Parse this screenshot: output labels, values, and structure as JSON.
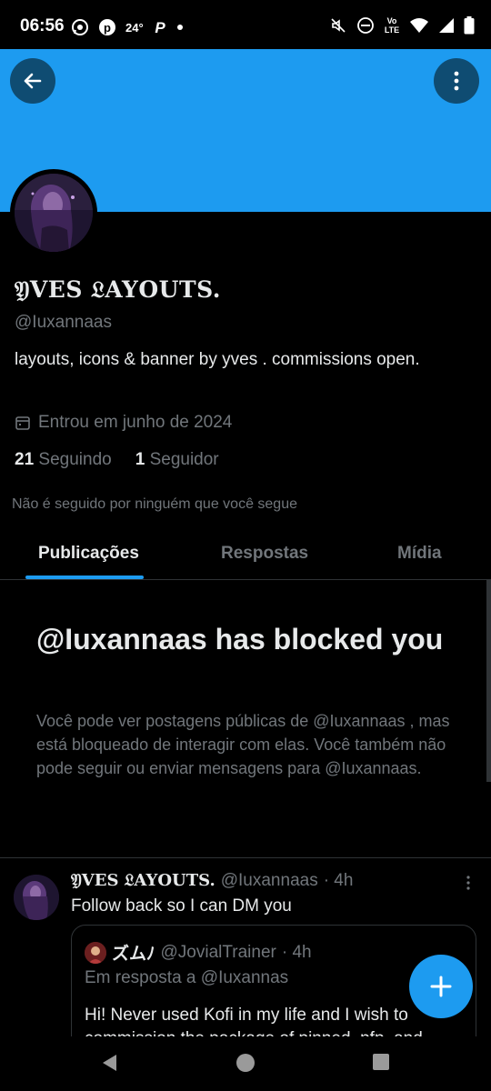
{
  "status_bar": {
    "time": "06:56",
    "temperature": "24°",
    "lte_label": "Vo LTE",
    "icons_left": [
      "whatsapp-icon",
      "pinterest-icon",
      "paypal-icon",
      "dot-icon"
    ],
    "icons_right": [
      "mute-icon",
      "dnd-icon",
      "volte-icon",
      "wifi-icon",
      "signal-icon",
      "battery-icon"
    ]
  },
  "header": {
    "back_icon": "arrow-left-icon",
    "more_icon": "more-vertical-icon",
    "banner_color": "#1d9bf0"
  },
  "profile": {
    "display_name": "𝔜VES 𝔏AYOUTS.",
    "handle": "@Iuxannaas",
    "bio": "layouts,  icons  &  banner  by  yves .     commissions open.",
    "joined": "Entrou em junho de 2024",
    "following_count": "21",
    "following_label": "Seguindo",
    "followers_count": "1",
    "followers_label": "Seguidor",
    "not_followed_text": "Não é seguido por ninguém que você segue"
  },
  "tabs": [
    {
      "label": "Publicações",
      "active": true
    },
    {
      "label": "Respostas",
      "active": false
    },
    {
      "label": "Mídia",
      "active": false
    }
  ],
  "blocked": {
    "title": "@Iuxannaas has blocked you",
    "description": "Você pode ver postagens públicas de @Iuxannaas , mas está bloqueado de interagir com elas. Você também não pode seguir ou enviar mensagens para @Iuxannaas."
  },
  "post": {
    "name": "𝔜VES 𝔏AYOUTS.",
    "handle": "@Iuxannaas",
    "time": "· 4h",
    "text": "Follow back so I can DM you",
    "quote": {
      "name": "ズムﾉ",
      "handle": "@JovialTrainer",
      "time": "· 4h",
      "reply_to": "Em resposta a @Iuxannas",
      "text": "Hi! Never used Kofi in my life and I wish to commission the package of pinned, pfp, and"
    }
  },
  "fab": {
    "icon": "plus-icon",
    "color": "#1d9bf0"
  },
  "nav_bar": {
    "icons": [
      "back-triangle-icon",
      "home-circle-icon",
      "recents-square-icon"
    ]
  }
}
